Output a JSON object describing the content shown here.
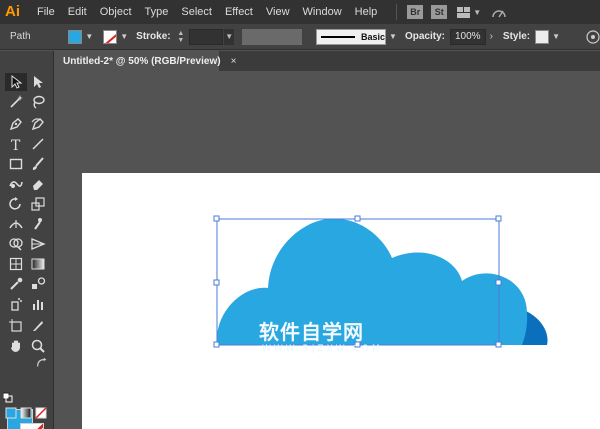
{
  "app": {
    "logo_text": "Ai",
    "accent": "#ff9a00"
  },
  "menu": {
    "items": [
      "File",
      "Edit",
      "Object",
      "Type",
      "Select",
      "Effect",
      "View",
      "Window",
      "Help"
    ],
    "bridge_label": "Br",
    "stock_label": "St"
  },
  "control_bar": {
    "selection_label": "Path",
    "fill_color": "#29a7e1",
    "stroke_label": "Stroke:",
    "brush_label": "Basic",
    "opacity_label": "Opacity:",
    "opacity_value": "100%",
    "style_label": "Style:"
  },
  "document": {
    "tab_title": "Untitled-2* @ 50% (RGB/Preview)",
    "close_glyph": "×"
  },
  "artwork": {
    "cloud_front_color": "#29a7e1",
    "cloud_back_color": "#0a6fbd",
    "watermark_text": "软件自学网",
    "watermark_sub": "WWW.RJZXW.COM"
  },
  "toolbar": {
    "fill_color": "#29a7e1",
    "tools": [
      "selection-tool",
      "direct-selection-tool",
      "magic-wand-tool",
      "lasso-tool",
      "pen-tool",
      "curvature-tool",
      "type-tool",
      "line-tool",
      "rectangle-tool",
      "paintbrush-tool",
      "shaper-tool",
      "eraser-tool",
      "rotate-tool",
      "scale-tool",
      "width-tool",
      "puppet-warp-tool",
      "shape-builder-tool",
      "perspective-grid-tool",
      "mesh-tool",
      "gradient-tool",
      "eyedropper-tool",
      "blend-tool",
      "symbol-sprayer-tool",
      "column-graph-tool",
      "artboard-tool",
      "slice-tool",
      "hand-tool",
      "zoom-tool"
    ]
  }
}
